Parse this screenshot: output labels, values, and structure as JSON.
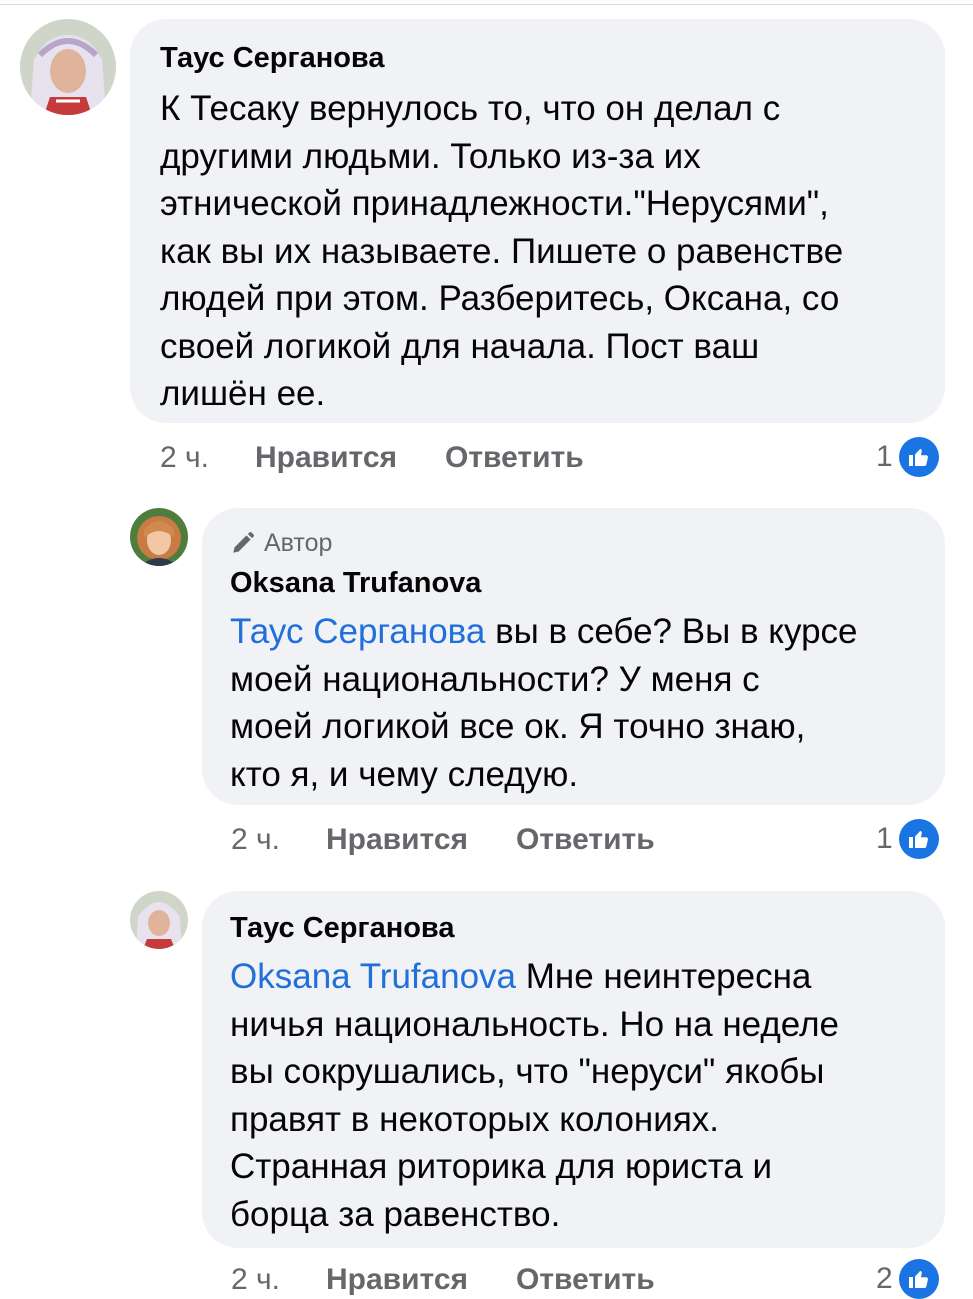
{
  "comments": [
    {
      "author": "Таус Серганова",
      "badge": "",
      "lines": [
        "К Тесаку вернулось то, что он делал с",
        "другими людьми.  Только из-за их",
        "этнической принадлежности.\"Нерусями\",",
        "как вы их называете. Пишете о равенстве",
        "людей при этом. Разберитесь, Оксана, со",
        "своей логикой для начала. Пост ваш",
        "лишён ее."
      ],
      "time": "2 ч.",
      "like_label": "Нравится",
      "reply_label": "Ответить",
      "reaction_count": "1"
    },
    {
      "author": "Oksana Trufanova",
      "badge": "Автор",
      "mention": "Таус Серганова",
      "first_line_rest": " вы в себе? Вы в курсе",
      "lines": [
        "моей национальности?  У меня с",
        "моей логикой все ок. Я точно знаю,",
        "кто я, и чему следую."
      ],
      "time": "2 ч.",
      "like_label": "Нравится",
      "reply_label": "Ответить",
      "reaction_count": "1"
    },
    {
      "author": "Таус Серганова",
      "badge": "",
      "mention": "Oksana Trufanova",
      "first_line_rest": " Мне неинтересна",
      "lines": [
        "ничья национальность. Но на неделе",
        "вы сокрушались, что \"неруси\" якобы",
        "правят в некоторых колониях.",
        "Странная риторика для юриста и",
        "борца за равенство."
      ],
      "time": "2 ч.",
      "like_label": "Нравится",
      "reply_label": "Ответить",
      "reaction_count": "2"
    }
  ],
  "colors": {
    "bubble": "#f0f2f5",
    "mention": "#216fdb",
    "meta": "#65676b",
    "like": "#1b74e4"
  },
  "icons": {
    "author_badge": "pencil-icon",
    "reaction": "thumbs-up-icon"
  }
}
